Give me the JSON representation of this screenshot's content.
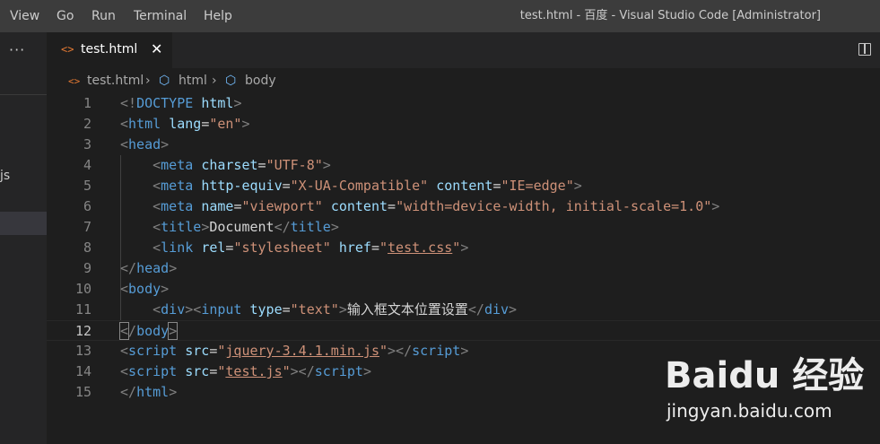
{
  "menu": {
    "view": "View",
    "go": "Go",
    "run": "Run",
    "terminal": "Terminal",
    "help": "Help"
  },
  "window_title": "test.html - 百度 - Visual Studio Code [Administrator]",
  "sidebar": {
    "more": "···",
    "file_fragment": "js"
  },
  "tab": {
    "icon": "<>",
    "label": "test.html",
    "close": "✕"
  },
  "breadcrumb": {
    "file": "test.html",
    "sep": "›",
    "html": "html",
    "body": "body"
  },
  "editor": {
    "active_line": 12,
    "line_numbers": [
      "1",
      "2",
      "3",
      "4",
      "5",
      "6",
      "7",
      "8",
      "9",
      "10",
      "11",
      "12",
      "13",
      "14",
      "15"
    ],
    "lines": [
      [
        [
          "t",
          "<!"
        ],
        [
          "tag",
          "DOCTYPE"
        ],
        [
          "txt",
          " "
        ],
        [
          "attr",
          "html"
        ],
        [
          "t",
          ">"
        ]
      ],
      [
        [
          "t",
          "<"
        ],
        [
          "tag",
          "html"
        ],
        [
          "txt",
          " "
        ],
        [
          "attr",
          "lang"
        ],
        [
          "txt",
          "="
        ],
        [
          "str",
          "\"en\""
        ],
        [
          "t",
          ">"
        ]
      ],
      [
        [
          "t",
          "<"
        ],
        [
          "tag",
          "head"
        ],
        [
          "t",
          ">"
        ]
      ],
      [
        [
          "txt",
          "    "
        ],
        [
          "t",
          "<"
        ],
        [
          "tag",
          "meta"
        ],
        [
          "txt",
          " "
        ],
        [
          "attr",
          "charset"
        ],
        [
          "txt",
          "="
        ],
        [
          "str",
          "\"UTF-8\""
        ],
        [
          "t",
          ">"
        ]
      ],
      [
        [
          "txt",
          "    "
        ],
        [
          "t",
          "<"
        ],
        [
          "tag",
          "meta"
        ],
        [
          "txt",
          " "
        ],
        [
          "attr",
          "http-equiv"
        ],
        [
          "txt",
          "="
        ],
        [
          "str",
          "\"X-UA-Compatible\""
        ],
        [
          "txt",
          " "
        ],
        [
          "attr",
          "content"
        ],
        [
          "txt",
          "="
        ],
        [
          "str",
          "\"IE=edge\""
        ],
        [
          "t",
          ">"
        ]
      ],
      [
        [
          "txt",
          "    "
        ],
        [
          "t",
          "<"
        ],
        [
          "tag",
          "meta"
        ],
        [
          "txt",
          " "
        ],
        [
          "attr",
          "name"
        ],
        [
          "txt",
          "="
        ],
        [
          "str",
          "\"viewport\""
        ],
        [
          "txt",
          " "
        ],
        [
          "attr",
          "content"
        ],
        [
          "txt",
          "="
        ],
        [
          "str",
          "\"width=device-width, initial-scale=1.0\""
        ],
        [
          "t",
          ">"
        ]
      ],
      [
        [
          "txt",
          "    "
        ],
        [
          "t",
          "<"
        ],
        [
          "tag",
          "title"
        ],
        [
          "t",
          ">"
        ],
        [
          "txt",
          "Document"
        ],
        [
          "t",
          "</"
        ],
        [
          "tag",
          "title"
        ],
        [
          "t",
          ">"
        ]
      ],
      [
        [
          "txt",
          "    "
        ],
        [
          "t",
          "<"
        ],
        [
          "tag",
          "link"
        ],
        [
          "txt",
          " "
        ],
        [
          "attr",
          "rel"
        ],
        [
          "txt",
          "="
        ],
        [
          "str",
          "\"stylesheet\""
        ],
        [
          "txt",
          " "
        ],
        [
          "attr",
          "href"
        ],
        [
          "txt",
          "="
        ],
        [
          "str",
          "\""
        ],
        [
          "str ul",
          "test.css"
        ],
        [
          "str",
          "\""
        ],
        [
          "t",
          ">"
        ]
      ],
      [
        [
          "t",
          "</"
        ],
        [
          "tag",
          "head"
        ],
        [
          "t",
          ">"
        ]
      ],
      [
        [
          "t",
          "<"
        ],
        [
          "tag",
          "body"
        ],
        [
          "t",
          ">"
        ]
      ],
      [
        [
          "txt",
          "    "
        ],
        [
          "t",
          "<"
        ],
        [
          "tag",
          "div"
        ],
        [
          "t",
          "><"
        ],
        [
          "tag",
          "input"
        ],
        [
          "txt",
          " "
        ],
        [
          "attr",
          "type"
        ],
        [
          "txt",
          "="
        ],
        [
          "str",
          "\"text\""
        ],
        [
          "t",
          ">"
        ],
        [
          "txt",
          "输入框文本位置设置"
        ],
        [
          "t",
          "</"
        ],
        [
          "tag",
          "div"
        ],
        [
          "t",
          ">"
        ]
      ],
      [
        [
          "t bracket",
          "<"
        ],
        [
          "t",
          "/"
        ],
        [
          "tag",
          "body"
        ],
        [
          "t bracket",
          ">"
        ]
      ],
      [
        [
          "t",
          "<"
        ],
        [
          "tag",
          "script"
        ],
        [
          "txt",
          " "
        ],
        [
          "attr",
          "src"
        ],
        [
          "txt",
          "="
        ],
        [
          "str",
          "\""
        ],
        [
          "str ul",
          "jquery-3.4.1.min.js"
        ],
        [
          "str",
          "\""
        ],
        [
          "t",
          "></"
        ],
        [
          "tag",
          "script"
        ],
        [
          "t",
          ">"
        ]
      ],
      [
        [
          "t",
          "<"
        ],
        [
          "tag",
          "script"
        ],
        [
          "txt",
          " "
        ],
        [
          "attr",
          "src"
        ],
        [
          "txt",
          "="
        ],
        [
          "str",
          "\""
        ],
        [
          "str ul",
          "test.js"
        ],
        [
          "str",
          "\""
        ],
        [
          "t",
          "></"
        ],
        [
          "tag",
          "script"
        ],
        [
          "t",
          ">"
        ]
      ],
      [
        [
          "t",
          "</"
        ],
        [
          "tag",
          "html"
        ],
        [
          "t",
          ">"
        ]
      ]
    ]
  },
  "watermark": {
    "logo": "Baidu 经验",
    "url": "jingyan.baidu.com"
  }
}
